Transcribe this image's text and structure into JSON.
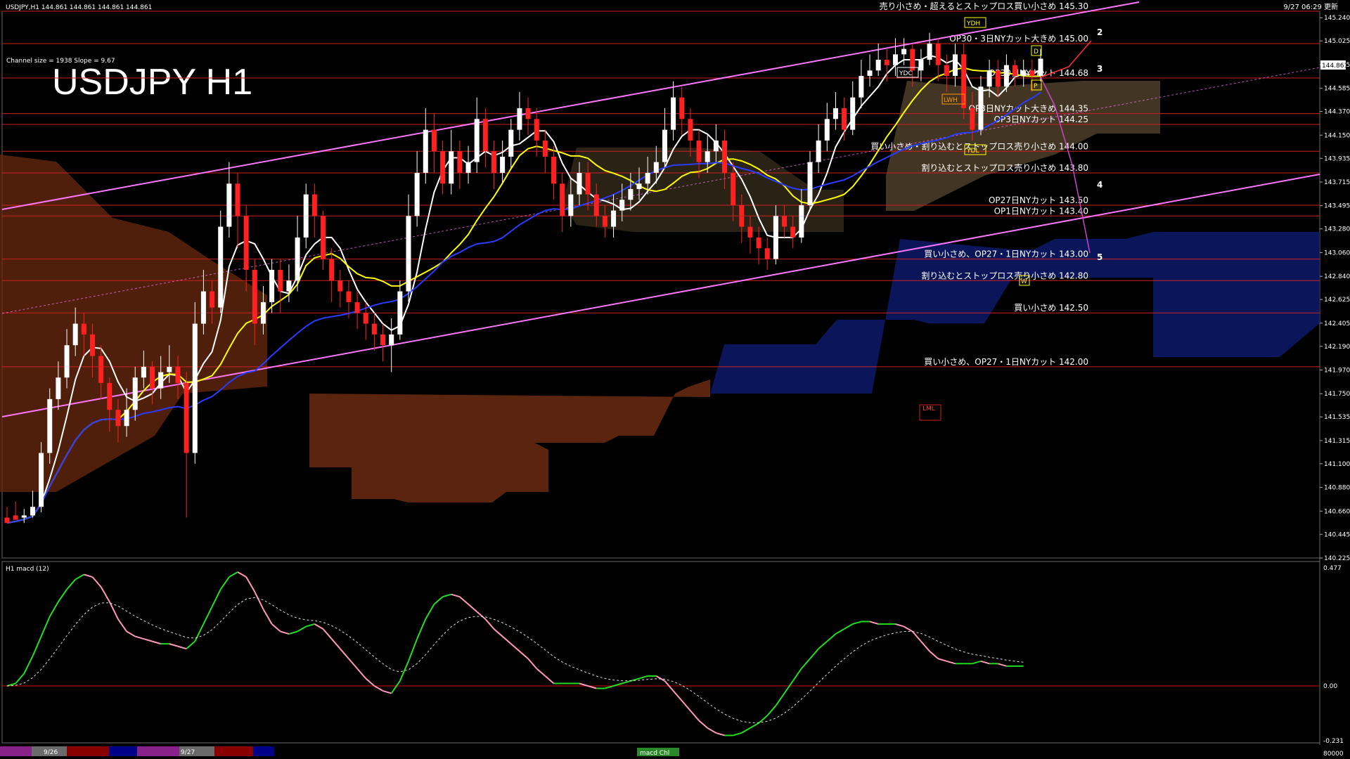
{
  "header": {
    "symbol_line": "USDJPY,H1  144.861 144.861 144.861 144.861",
    "updated": "9/27 06:29 更新"
  },
  "overlay": {
    "channel_info": "Channel size = 1938 Slope = 9.67",
    "big_title": "USDJPY H1"
  },
  "macd_panel": {
    "label": "H1  macd (12)",
    "top_value": "0.477",
    "zero_value": "0.00",
    "bottom_value": "-0.231"
  },
  "bottom_bar": {
    "dates": [
      "9/26",
      "9/27"
    ],
    "tab_label": "macd Chl",
    "right_value": "80000"
  },
  "colors": {
    "bull": "#ffffff",
    "bear": "#ff2020",
    "level": "#cc2020",
    "channel": "#ff77ff",
    "ma_fast": "#ffffff",
    "ma_mid": "#ffff00",
    "ma_slow": "#2a3cff",
    "macd_up": "#22dd22",
    "macd_down": "#ff99bb",
    "cloud_blue": "#1a2a8a",
    "cloud_brown": "#8a3a1a"
  },
  "chart_data": {
    "type": "candlestick",
    "ylim": [
      140.225,
      145.3
    ],
    "y_ticks": [
      145.24,
      145.025,
      144.805,
      144.585,
      144.37,
      144.15,
      143.935,
      143.715,
      143.495,
      143.28,
      143.06,
      142.84,
      142.625,
      142.405,
      142.19,
      141.97,
      141.75,
      141.535,
      141.315,
      141.1,
      140.88,
      140.66,
      140.445,
      140.225
    ],
    "current_price": "144.861",
    "candles": [
      [
        140.6,
        140.55,
        140.7,
        140.6
      ],
      [
        140.62,
        140.58,
        140.75,
        140.58
      ],
      [
        140.6,
        140.62,
        140.68,
        140.55
      ],
      [
        140.62,
        140.7,
        140.85,
        140.6
      ],
      [
        140.7,
        141.2,
        141.3,
        140.65
      ],
      [
        141.2,
        141.7,
        141.8,
        141.1
      ],
      [
        141.7,
        141.9,
        142.05,
        141.6
      ],
      [
        141.9,
        142.2,
        142.35,
        141.8
      ],
      [
        142.2,
        142.4,
        142.55,
        142.1
      ],
      [
        142.4,
        142.3,
        142.5,
        142.1
      ],
      [
        142.3,
        142.1,
        142.4,
        141.9
      ],
      [
        142.1,
        141.85,
        142.2,
        141.7
      ],
      [
        141.85,
        141.6,
        141.9,
        141.4
      ],
      [
        141.6,
        141.45,
        141.7,
        141.3
      ],
      [
        141.45,
        141.6,
        141.8,
        141.35
      ],
      [
        141.6,
        141.9,
        142.0,
        141.5
      ],
      [
        141.9,
        142.0,
        142.15,
        141.8
      ],
      [
        142.0,
        141.8,
        142.05,
        141.65
      ],
      [
        141.8,
        141.95,
        142.1,
        141.7
      ],
      [
        141.95,
        142.0,
        142.2,
        141.85
      ],
      [
        142.0,
        141.85,
        142.1,
        141.7
      ],
      [
        141.85,
        141.2,
        141.95,
        140.6
      ],
      [
        141.2,
        142.4,
        142.6,
        141.1
      ],
      [
        142.4,
        142.7,
        142.9,
        142.3
      ],
      [
        142.7,
        142.55,
        142.8,
        142.4
      ],
      [
        142.55,
        143.3,
        143.45,
        142.5
      ],
      [
        143.3,
        143.7,
        143.9,
        143.2
      ],
      [
        143.7,
        143.4,
        143.8,
        143.1
      ],
      [
        143.4,
        142.9,
        143.5,
        142.7
      ],
      [
        142.9,
        142.4,
        143.0,
        142.2
      ],
      [
        142.4,
        142.6,
        142.75,
        142.3
      ],
      [
        142.6,
        142.9,
        143.0,
        142.5
      ],
      [
        142.9,
        142.7,
        143.0,
        142.5
      ],
      [
        142.7,
        142.8,
        142.95,
        142.6
      ],
      [
        142.8,
        143.2,
        143.4,
        142.7
      ],
      [
        143.2,
        143.6,
        143.7,
        143.1
      ],
      [
        143.6,
        143.4,
        143.7,
        143.2
      ],
      [
        143.4,
        143.0,
        143.45,
        142.9
      ],
      [
        143.0,
        142.8,
        143.1,
        142.6
      ],
      [
        142.8,
        142.7,
        142.9,
        142.55
      ],
      [
        142.7,
        142.6,
        142.8,
        142.45
      ],
      [
        142.6,
        142.5,
        142.7,
        142.35
      ],
      [
        142.5,
        142.4,
        142.6,
        142.25
      ],
      [
        142.4,
        142.3,
        142.5,
        142.15
      ],
      [
        142.3,
        142.2,
        142.4,
        142.05
      ],
      [
        142.2,
        142.3,
        142.45,
        141.95
      ],
      [
        142.3,
        142.7,
        142.8,
        142.25
      ],
      [
        142.7,
        143.4,
        143.6,
        142.6
      ],
      [
        143.4,
        143.8,
        144.0,
        143.3
      ],
      [
        143.8,
        144.2,
        144.4,
        143.7
      ],
      [
        144.2,
        144.0,
        144.35,
        143.8
      ],
      [
        144.0,
        143.7,
        144.1,
        143.6
      ],
      [
        143.7,
        144.0,
        144.2,
        143.6
      ],
      [
        144.0,
        143.8,
        144.1,
        143.65
      ],
      [
        143.8,
        143.9,
        144.05,
        143.7
      ],
      [
        143.9,
        144.3,
        144.5,
        143.8
      ],
      [
        144.3,
        144.0,
        144.4,
        143.85
      ],
      [
        144.0,
        143.8,
        144.1,
        143.65
      ],
      [
        143.8,
        143.95,
        144.1,
        143.7
      ],
      [
        143.95,
        144.2,
        144.3,
        143.85
      ],
      [
        144.2,
        144.4,
        144.55,
        144.1
      ],
      [
        144.4,
        144.3,
        144.5,
        144.15
      ],
      [
        144.3,
        144.1,
        144.4,
        143.95
      ],
      [
        144.1,
        143.95,
        144.2,
        143.8
      ],
      [
        143.95,
        143.7,
        144.05,
        143.55
      ],
      [
        143.7,
        143.4,
        143.8,
        143.25
      ],
      [
        143.4,
        143.6,
        143.75,
        143.3
      ],
      [
        143.6,
        143.8,
        143.9,
        143.5
      ],
      [
        143.8,
        143.6,
        143.9,
        143.45
      ],
      [
        143.6,
        143.4,
        143.7,
        143.3
      ],
      [
        143.4,
        143.3,
        143.5,
        143.2
      ],
      [
        143.3,
        143.45,
        143.6,
        143.2
      ],
      [
        143.45,
        143.55,
        143.7,
        143.35
      ],
      [
        143.55,
        143.65,
        143.8,
        143.45
      ],
      [
        143.65,
        143.7,
        143.85,
        143.55
      ],
      [
        143.7,
        143.8,
        143.95,
        143.6
      ],
      [
        143.8,
        143.9,
        144.05,
        143.7
      ],
      [
        143.9,
        144.2,
        144.4,
        143.85
      ],
      [
        144.2,
        144.5,
        144.65,
        144.1
      ],
      [
        144.5,
        144.3,
        144.6,
        144.15
      ],
      [
        144.3,
        144.1,
        144.4,
        143.95
      ],
      [
        144.1,
        143.9,
        144.2,
        143.75
      ],
      [
        143.9,
        144.0,
        144.15,
        143.8
      ],
      [
        144.0,
        144.1,
        144.25,
        143.9
      ],
      [
        144.1,
        143.8,
        144.2,
        143.65
      ],
      [
        143.8,
        143.5,
        143.9,
        143.35
      ],
      [
        143.5,
        143.3,
        143.6,
        143.15
      ],
      [
        143.3,
        143.2,
        143.4,
        143.05
      ],
      [
        143.2,
        143.1,
        143.3,
        142.95
      ],
      [
        143.1,
        143.0,
        143.2,
        142.9
      ],
      [
        143.0,
        143.4,
        143.5,
        142.95
      ],
      [
        143.4,
        143.3,
        143.5,
        143.2
      ],
      [
        143.3,
        143.2,
        143.4,
        143.1
      ],
      [
        143.2,
        143.5,
        143.65,
        143.15
      ],
      [
        143.5,
        143.9,
        144.0,
        143.45
      ],
      [
        143.9,
        144.1,
        144.25,
        143.8
      ],
      [
        144.1,
        144.3,
        144.45,
        144.0
      ],
      [
        144.3,
        144.4,
        144.55,
        144.2
      ],
      [
        144.4,
        144.2,
        144.5,
        144.1
      ],
      [
        144.2,
        144.5,
        144.65,
        144.15
      ],
      [
        144.5,
        144.7,
        144.85,
        144.4
      ],
      [
        144.7,
        144.75,
        144.9,
        144.6
      ],
      [
        144.75,
        144.85,
        145.0,
        144.7
      ],
      [
        144.85,
        144.8,
        144.95,
        144.65
      ],
      [
        144.8,
        144.9,
        145.05,
        144.7
      ],
      [
        144.9,
        144.95,
        145.05,
        144.8
      ],
      [
        144.95,
        144.75,
        145.0,
        144.6
      ],
      [
        144.75,
        144.85,
        144.95,
        144.65
      ],
      [
        144.85,
        145.0,
        145.1,
        144.8
      ],
      [
        145.0,
        144.8,
        145.05,
        144.65
      ],
      [
        144.8,
        144.7,
        144.9,
        144.55
      ],
      [
        144.7,
        144.9,
        145.0,
        144.6
      ],
      [
        144.9,
        144.4,
        145.0,
        144.3
      ],
      [
        144.4,
        144.2,
        144.55,
        144.1
      ],
      [
        144.2,
        144.6,
        144.7,
        144.15
      ],
      [
        144.6,
        144.75,
        144.85,
        144.5
      ],
      [
        144.75,
        144.6,
        144.85,
        144.5
      ],
      [
        144.6,
        144.8,
        144.9,
        144.55
      ],
      [
        144.8,
        144.7,
        144.85,
        144.6
      ],
      [
        144.7,
        144.75,
        144.85,
        144.6
      ],
      [
        144.75,
        144.7,
        144.85,
        144.55
      ],
      [
        144.7,
        144.86,
        144.95,
        144.65
      ]
    ],
    "levels": [
      {
        "price": 145.3,
        "label": "売り小さめ・超えるとストップロス買い小さめ 145.30"
      },
      {
        "price": 145.0,
        "label": "OP30・3日NYカット大きめ 145.00"
      },
      {
        "price": 144.68,
        "label": "OP30日NYカット 144.68"
      },
      {
        "price": 144.35,
        "label": "OP3日NYカット大きめ 144.35"
      },
      {
        "price": 144.25,
        "label": "OP3日NYカット 144.25"
      },
      {
        "price": 144.0,
        "label": "買い小さめ・割り込むとストップロス売り小さめ 144.00"
      },
      {
        "price": 143.8,
        "label": "割り込むとストップロス売り小さめ 143.80"
      },
      {
        "price": 143.5,
        "label": "OP27日NYカット 143.50"
      },
      {
        "price": 143.4,
        "label": "OP1日NYカット 143.40"
      },
      {
        "price": 143.0,
        "label": "買い小さめ、OP27・1日NYカット 143.00"
      },
      {
        "price": 142.8,
        "label": "割り込むとストップロス売り小さめ 142.80"
      },
      {
        "price": 142.5,
        "label": "買い小さめ 142.50"
      },
      {
        "price": 142.0,
        "label": "買い小さめ、OP27・1日NYカット 142.00"
      }
    ],
    "wave_labels": [
      "2",
      "3",
      "4",
      "5"
    ],
    "box_tags": [
      "YDH",
      "YDC",
      "LWH",
      "YDL",
      "LML",
      "D",
      "P",
      "W"
    ],
    "macd": [
      0.0,
      0.01,
      0.05,
      0.12,
      0.2,
      0.28,
      0.34,
      0.39,
      0.43,
      0.45,
      0.44,
      0.4,
      0.34,
      0.27,
      0.22,
      0.2,
      0.19,
      0.18,
      0.17,
      0.17,
      0.16,
      0.15,
      0.18,
      0.25,
      0.32,
      0.39,
      0.44,
      0.46,
      0.44,
      0.38,
      0.31,
      0.25,
      0.22,
      0.21,
      0.22,
      0.24,
      0.25,
      0.23,
      0.19,
      0.15,
      0.11,
      0.07,
      0.03,
      0.0,
      -0.02,
      -0.03,
      0.02,
      0.1,
      0.19,
      0.27,
      0.33,
      0.36,
      0.37,
      0.36,
      0.33,
      0.3,
      0.27,
      0.23,
      0.2,
      0.17,
      0.14,
      0.11,
      0.07,
      0.04,
      0.01,
      0.01,
      0.01,
      0.01,
      0.0,
      -0.01,
      -0.01,
      0.0,
      0.01,
      0.02,
      0.03,
      0.04,
      0.04,
      0.02,
      -0.02,
      -0.06,
      -0.1,
      -0.14,
      -0.17,
      -0.19,
      -0.2,
      -0.2,
      -0.19,
      -0.17,
      -0.15,
      -0.12,
      -0.08,
      -0.03,
      0.02,
      0.07,
      0.11,
      0.15,
      0.18,
      0.21,
      0.23,
      0.25,
      0.26,
      0.26,
      0.25,
      0.25,
      0.25,
      0.24,
      0.22,
      0.18,
      0.14,
      0.11,
      0.1,
      0.09,
      0.09,
      0.09,
      0.1,
      0.09,
      0.09,
      0.08,
      0.08,
      0.08
    ]
  }
}
